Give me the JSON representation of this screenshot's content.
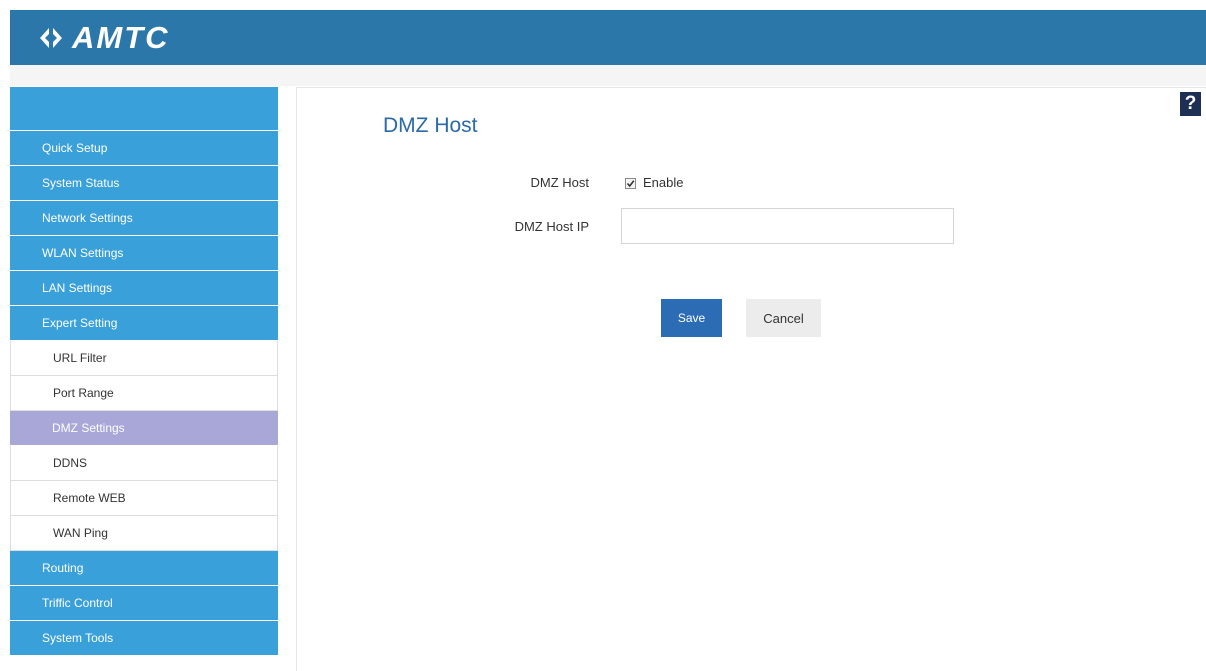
{
  "brand": {
    "logo_text": "AMTC",
    "header_color": "#2b77aa"
  },
  "sidebar": {
    "items": [
      {
        "label": "Quick Setup",
        "type": "top"
      },
      {
        "label": "System Status",
        "type": "top"
      },
      {
        "label": "Network Settings",
        "type": "top"
      },
      {
        "label": "WLAN Settings",
        "type": "top"
      },
      {
        "label": "LAN Settings",
        "type": "top"
      },
      {
        "label": "Expert Setting",
        "type": "top"
      },
      {
        "label": "URL Filter",
        "type": "sub"
      },
      {
        "label": "Port Range",
        "type": "sub"
      },
      {
        "label": "DMZ Settings",
        "type": "sub",
        "active": true
      },
      {
        "label": "DDNS",
        "type": "sub"
      },
      {
        "label": "Remote WEB",
        "type": "sub"
      },
      {
        "label": "WAN Ping",
        "type": "sub"
      },
      {
        "label": "Routing",
        "type": "top"
      },
      {
        "label": "Triffic Control",
        "type": "top"
      },
      {
        "label": "System Tools",
        "type": "top"
      }
    ],
    "colors": {
      "top_item": "#3aa0d9",
      "active_item": "#a9a7d8"
    }
  },
  "main": {
    "help_label": "?",
    "title": "DMZ Host",
    "form": {
      "dmz_host_label": "DMZ Host",
      "enable_label": "Enable",
      "enable_checked": true,
      "dmz_ip_label": "DMZ Host IP",
      "dmz_ip_value": "",
      "save_label": "Save",
      "cancel_label": "Cancel"
    },
    "colors": {
      "title": "#2a6aa8",
      "save_button": "#2b6cb5"
    }
  }
}
